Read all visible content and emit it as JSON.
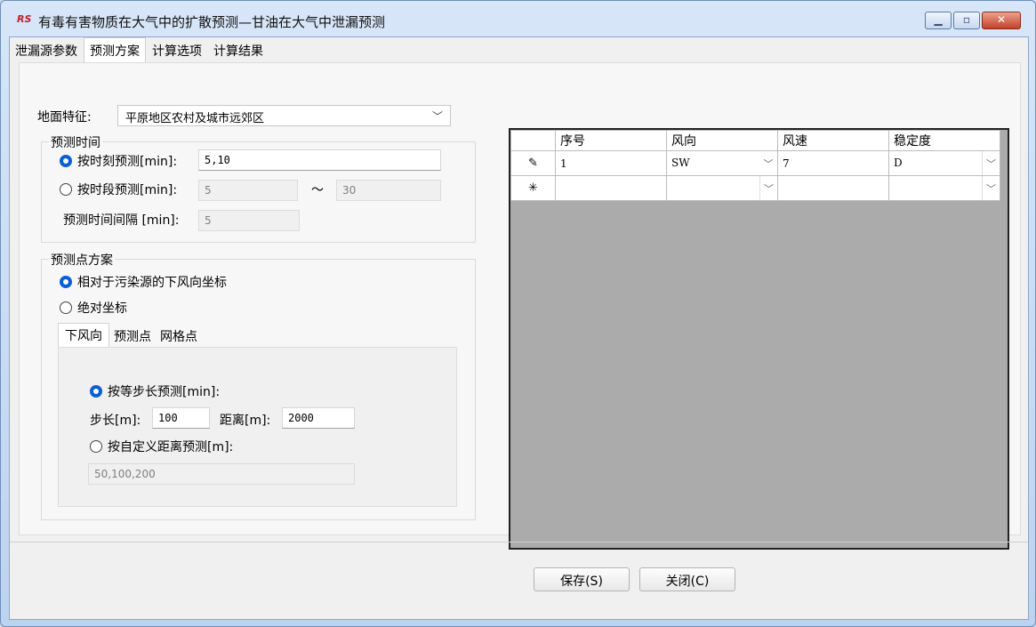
{
  "window": {
    "icon_text": "RS",
    "title": "有毒有害物质在大气中的扩散预测—甘油在大气中泄漏预测",
    "controls": {
      "minimize": "minimize-icon",
      "maximize": "maximize-icon",
      "close": "close-icon"
    }
  },
  "tabs": [
    "泄漏源参数",
    "预测方案",
    "计算选项",
    "计算结果"
  ],
  "active_tab": "预测方案",
  "ground": {
    "label": "地面特征:",
    "value": "平原地区农村及城市远郊区"
  },
  "predict_time": {
    "title": "预测时间",
    "by_moment": {
      "label": "按时刻预测[min]:",
      "value": "5,10",
      "checked": true
    },
    "by_period": {
      "label": "按时段预测[min]:",
      "from": "5",
      "tilde": "～",
      "to": "30",
      "checked": false
    },
    "interval": {
      "label": "预测时间间隔 [min]:",
      "value": "5"
    }
  },
  "predict_points": {
    "title": "预测点方案",
    "relative": {
      "label": "相对于污染源的下风向坐标",
      "checked": true
    },
    "absolute": {
      "label": "绝对坐标",
      "checked": false
    },
    "subtabs": [
      "下风向",
      "预测点",
      "网格点"
    ],
    "active_subtab": "下风向",
    "equal_step": {
      "label": "按等步长预测[min]:",
      "checked": true
    },
    "step": {
      "label": "步长[m]:",
      "value": "100"
    },
    "distance": {
      "label": "距离[m]:",
      "value": "2000"
    },
    "custom": {
      "label": "按自定义距离预测[m]:",
      "value": "50,100,200",
      "checked": false
    }
  },
  "table": {
    "columns": [
      "序号",
      "风向",
      "风速",
      "稳定度"
    ],
    "rows": [
      {
        "marker": "✎",
        "no": "1",
        "direction": "SW",
        "speed": "7",
        "stability": "D"
      },
      {
        "marker": "✳",
        "no": "",
        "direction": "",
        "speed": "",
        "stability": ""
      }
    ]
  },
  "buttons": {
    "save": "保存(S)",
    "close": "关闭(C)"
  },
  "colors": {
    "accent": "#0a5fd8",
    "grid_bg": "#ababab",
    "close_button": "#c4402a"
  }
}
